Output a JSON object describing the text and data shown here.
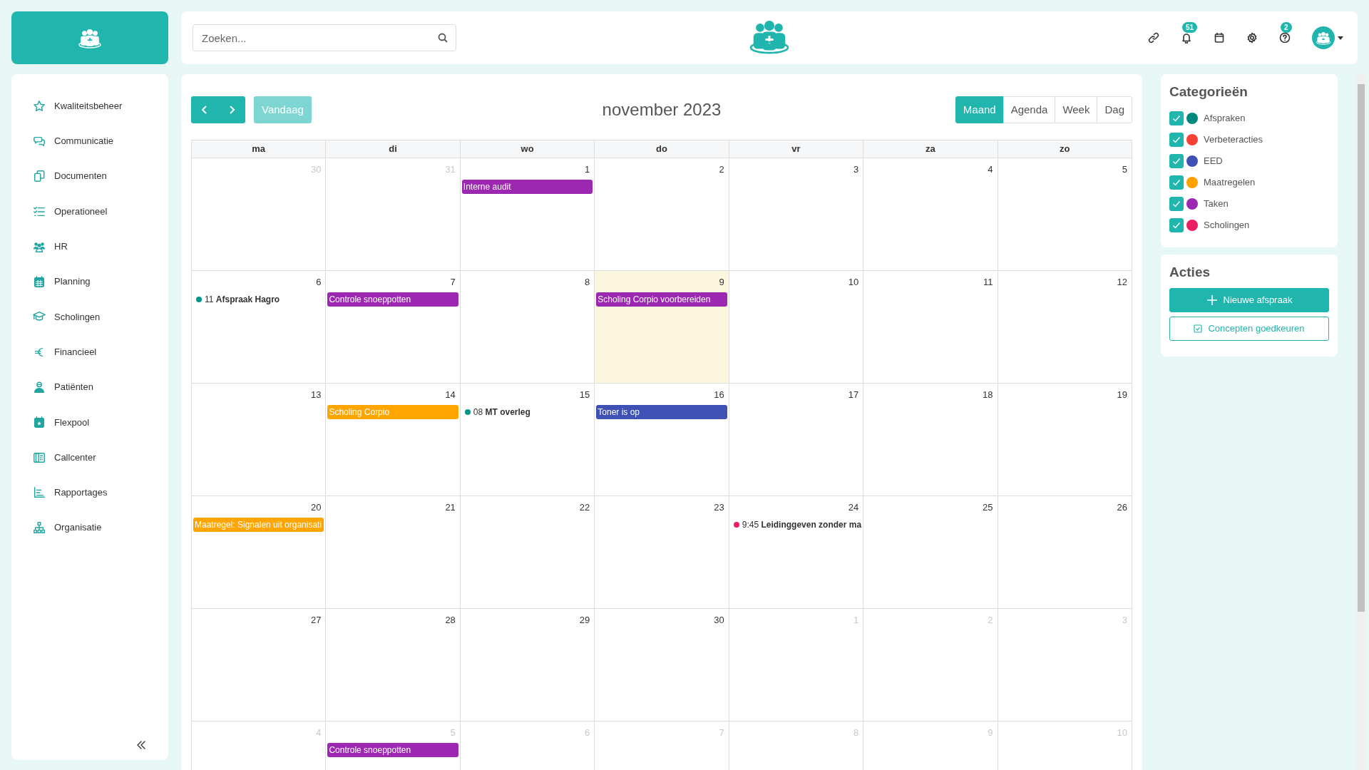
{
  "sidebar": {
    "items": [
      {
        "label": "Kwaliteitsbeheer"
      },
      {
        "label": "Communicatie"
      },
      {
        "label": "Documenten"
      },
      {
        "label": "Operationeel"
      },
      {
        "label": "HR"
      },
      {
        "label": "Planning"
      },
      {
        "label": "Scholingen"
      },
      {
        "label": "Financieel"
      },
      {
        "label": "Patiënten"
      },
      {
        "label": "Flexpool"
      },
      {
        "label": "Callcenter"
      },
      {
        "label": "Rapportages"
      },
      {
        "label": "Organisatie"
      }
    ]
  },
  "topbar": {
    "search": {
      "placeholder": "Zoeken..."
    },
    "notifications_badge": "51",
    "help_badge": "2"
  },
  "calendar": {
    "today_button": "Vandaag",
    "title": "november 2023",
    "views": [
      {
        "label": "Maand",
        "selected": true
      },
      {
        "label": "Agenda",
        "selected": false
      },
      {
        "label": "Week",
        "selected": false
      },
      {
        "label": "Dag",
        "selected": false
      }
    ],
    "weekdays": [
      "ma",
      "di",
      "wo",
      "do",
      "vr",
      "za",
      "zo"
    ],
    "weeks": [
      [
        {
          "day": "30",
          "other_month": true
        },
        {
          "day": "31",
          "other_month": true
        },
        {
          "day": "1",
          "events": [
            {
              "kind": "bar",
              "title": "Interne audit",
              "color": "#9c27b0"
            }
          ]
        },
        {
          "day": "2"
        },
        {
          "day": "3"
        },
        {
          "day": "4"
        },
        {
          "day": "5"
        }
      ],
      [
        {
          "day": "6",
          "events": [
            {
              "kind": "dot",
              "time": "11",
              "title": "Afspraak Hagro",
              "color": "#009688"
            }
          ]
        },
        {
          "day": "7",
          "events": [
            {
              "kind": "bar",
              "title": "Controle snoeppotten",
              "color": "#9c27b0"
            }
          ]
        },
        {
          "day": "8"
        },
        {
          "day": "9",
          "today": true,
          "events": [
            {
              "kind": "bar",
              "title": "Scholing Corpio voorbereiden",
              "color": "#9c27b0"
            }
          ]
        },
        {
          "day": "10"
        },
        {
          "day": "11"
        },
        {
          "day": "12"
        }
      ],
      [
        {
          "day": "13"
        },
        {
          "day": "14",
          "events": [
            {
              "kind": "bar",
              "title": "Scholing Corpio",
              "color": "#ffa500"
            }
          ]
        },
        {
          "day": "15",
          "events": [
            {
              "kind": "dot",
              "time": "08",
              "title": "MT overleg",
              "color": "#009688"
            }
          ]
        },
        {
          "day": "16",
          "events": [
            {
              "kind": "bar",
              "title": "Toner is op",
              "color": "#3f51b5"
            }
          ]
        },
        {
          "day": "17"
        },
        {
          "day": "18"
        },
        {
          "day": "19"
        }
      ],
      [
        {
          "day": "20",
          "events": [
            {
              "kind": "bar",
              "title": "Maatregel: Signalen uit organisati",
              "color": "#ffa500"
            }
          ]
        },
        {
          "day": "21"
        },
        {
          "day": "22"
        },
        {
          "day": "23"
        },
        {
          "day": "24",
          "events": [
            {
              "kind": "dot",
              "time": "9:45",
              "title": "Leidinggeven zonder ma",
              "color": "#e91e63"
            }
          ]
        },
        {
          "day": "25"
        },
        {
          "day": "26"
        }
      ],
      [
        {
          "day": "27"
        },
        {
          "day": "28"
        },
        {
          "day": "29"
        },
        {
          "day": "30"
        },
        {
          "day": "1",
          "other_month": true
        },
        {
          "day": "2",
          "other_month": true
        },
        {
          "day": "3",
          "other_month": true
        }
      ],
      [
        {
          "day": "4",
          "other_month": true
        },
        {
          "day": "5",
          "other_month": true,
          "events": [
            {
              "kind": "bar",
              "title": "Controle snoeppotten",
              "color": "#9c27b0"
            }
          ]
        },
        {
          "day": "6",
          "other_month": true
        },
        {
          "day": "7",
          "other_month": true
        },
        {
          "day": "8",
          "other_month": true
        },
        {
          "day": "9",
          "other_month": true
        },
        {
          "day": "10",
          "other_month": true
        }
      ]
    ]
  },
  "categories": {
    "title": "Categorieën",
    "items": [
      {
        "label": "Afspraken",
        "checked": true,
        "color": "#00897b"
      },
      {
        "label": "Verbeteracties",
        "checked": true,
        "color": "#f44336"
      },
      {
        "label": "EED",
        "checked": true,
        "color": "#3f51b5"
      },
      {
        "label": "Maatregelen",
        "checked": true,
        "color": "#ffa000"
      },
      {
        "label": "Taken",
        "checked": true,
        "color": "#9c27b0"
      },
      {
        "label": "Scholingen",
        "checked": true,
        "color": "#e91e63"
      }
    ]
  },
  "actions": {
    "title": "Acties",
    "buttons": [
      {
        "kind": "primary",
        "label": "Nieuwe afspraak"
      },
      {
        "kind": "outline",
        "label": "Concepten goedkeuren"
      }
    ]
  }
}
